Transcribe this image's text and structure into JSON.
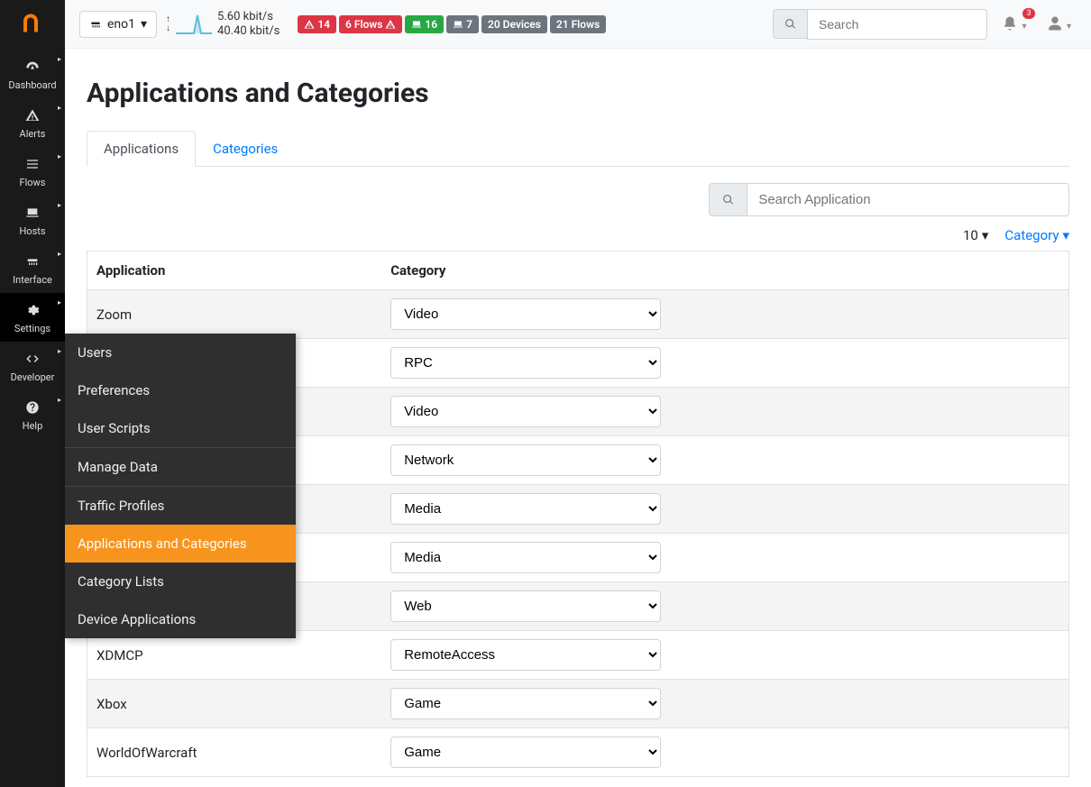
{
  "sidebar": {
    "items": [
      {
        "label": "Dashboard",
        "icon": "gauge"
      },
      {
        "label": "Alerts",
        "icon": "warn"
      },
      {
        "label": "Flows",
        "icon": "bars"
      },
      {
        "label": "Hosts",
        "icon": "laptop"
      },
      {
        "label": "Interface",
        "icon": "net"
      },
      {
        "label": "Settings",
        "icon": "gear",
        "active": true
      },
      {
        "label": "Developer",
        "icon": "code"
      },
      {
        "label": "Help",
        "icon": "help"
      }
    ]
  },
  "flyout": {
    "items": [
      {
        "label": "Users"
      },
      {
        "label": "Preferences"
      },
      {
        "label": "User Scripts"
      },
      {
        "label": "Manage Data",
        "sep": true
      },
      {
        "label": "Traffic Profiles",
        "sep": true
      },
      {
        "label": "Applications and Categories",
        "active": true
      },
      {
        "label": "Category Lists"
      },
      {
        "label": "Device Applications"
      }
    ]
  },
  "topbar": {
    "interface": "eno1",
    "speed_up": "5.60 kbit/s",
    "speed_down": "40.40 kbit/s",
    "badges": [
      {
        "text": "14",
        "cls": "b-red",
        "icon": "warn"
      },
      {
        "text": "6 Flows",
        "cls": "b-red",
        "iconAfter": "warn"
      },
      {
        "text": "16",
        "cls": "b-green",
        "icon": "laptop"
      },
      {
        "text": "7",
        "cls": "b-gray",
        "icon": "laptop"
      },
      {
        "text": "20 Devices",
        "cls": "b-gray"
      },
      {
        "text": "21 Flows",
        "cls": "b-gray"
      }
    ],
    "search_placeholder": "Search",
    "notif_count": "3"
  },
  "page": {
    "title": "Applications and Categories",
    "tabs": [
      {
        "label": "Applications",
        "active": true
      },
      {
        "label": "Categories"
      }
    ],
    "app_search_placeholder": "Search Application",
    "page_size": "10",
    "sort_label": "Category",
    "cols": {
      "app": "Application",
      "cat": "Category"
    },
    "rows": [
      {
        "app": "Zoom",
        "cat": "Video"
      },
      {
        "app": "",
        "cat": "RPC"
      },
      {
        "app": "",
        "cat": "Video"
      },
      {
        "app": "",
        "cat": "Network"
      },
      {
        "app": "",
        "cat": "Media"
      },
      {
        "app": "",
        "cat": "Media"
      },
      {
        "app": "",
        "cat": "Web"
      },
      {
        "app": "XDMCP",
        "cat": "RemoteAccess"
      },
      {
        "app": "Xbox",
        "cat": "Game"
      },
      {
        "app": "WorldOfWarcraft",
        "cat": "Game"
      }
    ],
    "cat_options": [
      "Video",
      "RPC",
      "Network",
      "Media",
      "Web",
      "RemoteAccess",
      "Game"
    ]
  }
}
